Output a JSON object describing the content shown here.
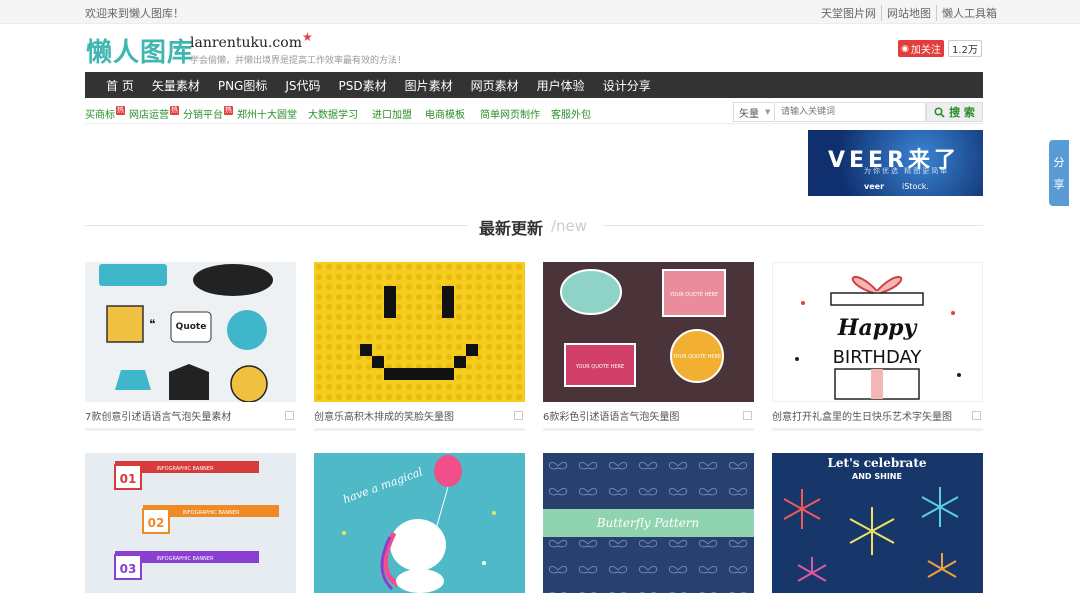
{
  "topbar": {
    "welcome": "欢迎来到懒人图库！",
    "links": [
      "天堂图片网",
      "网站地图",
      "懒人工具箱"
    ]
  },
  "logo": {
    "cn": "懒人图库",
    "en": "lanrentuku.com",
    "slogan": "学会偷懒，并懒出境界是提高工作效率最有效的方法！"
  },
  "weibo": {
    "follow": "加关注",
    "count": "1.2万"
  },
  "nav": [
    "首 页",
    "矢量素材",
    "PNG图标",
    "JS代码",
    "PSD素材",
    "图片素材",
    "网页素材",
    "用户体验",
    "设计分享"
  ],
  "subnav": [
    {
      "label": "买商标",
      "hot": true
    },
    {
      "label": "网店运营",
      "hot": true
    },
    {
      "label": "分销平台",
      "hot": true
    },
    {
      "label": "郑州十大圆堂",
      "hot": false
    },
    {
      "label": "大数据学习",
      "hot": false
    },
    {
      "label": "进口加盟",
      "hot": false
    },
    {
      "label": "电商模板",
      "hot": false
    },
    {
      "label": "简单网页制作",
      "hot": false
    },
    {
      "label": "客服外包",
      "hot": false
    }
  ],
  "hot_badge": "热",
  "search": {
    "category": "矢量",
    "placeholder": "请输入关键词",
    "button": "搜 索"
  },
  "ad": {
    "brand": "VEER来了",
    "tagline": "为你优选 精图更简单",
    "veer": "veer",
    "istock": "iStock."
  },
  "share_tab": [
    "分",
    "享"
  ],
  "section": {
    "title": "最新更新",
    "sub": "/new"
  },
  "cards": [
    {
      "caption": "7款创意引述语语言气泡矢量素材"
    },
    {
      "caption": "创意乐高积木排成的笑脸矢量图"
    },
    {
      "caption": "6款彩色引述语语言气泡矢量图"
    },
    {
      "caption": "创意打开礼盒里的生日快乐艺术字矢量图"
    },
    {
      "caption": ""
    },
    {
      "caption": ""
    },
    {
      "caption": ""
    },
    {
      "caption": ""
    }
  ],
  "card_art": {
    "quote_badge": "Quote",
    "your_quote_here": "YOUR QUOTE HERE",
    "happy": "Happy",
    "birthday": "BIRTHDAY",
    "infographic_banner": "INFOGRAPHIC BANNER",
    "infographic_numbers": [
      "01",
      "02",
      "03"
    ],
    "unicorn_text": "have a magical",
    "butterfly": "Butterfly Pattern",
    "celebrate": "Let's celebrate",
    "and_shine": "AND SHINE"
  }
}
